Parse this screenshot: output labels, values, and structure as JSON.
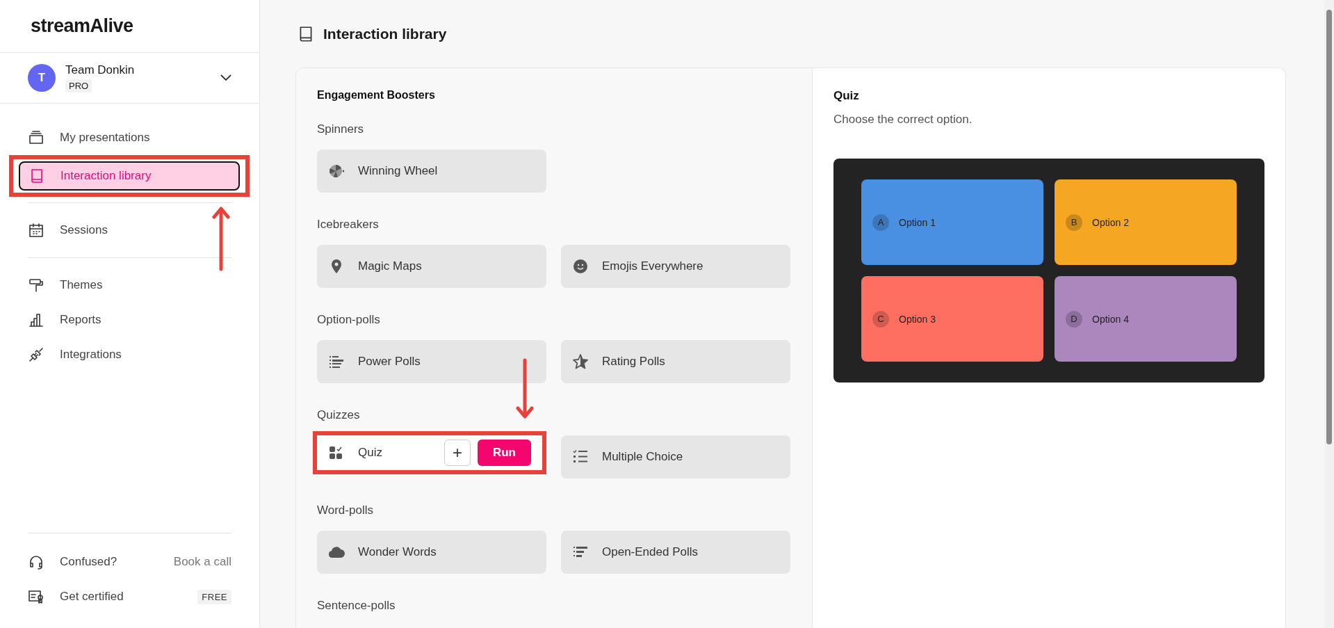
{
  "brand": {
    "logo": "streamAlive"
  },
  "team": {
    "initial": "T",
    "name": "Team Donkin",
    "plan": "PRO"
  },
  "nav_groups": [
    [
      {
        "label": "My presentations",
        "kind": "stack",
        "selected": false,
        "annotated": false
      },
      {
        "label": "Interaction library",
        "kind": "book",
        "selected": true,
        "annotated": true
      }
    ],
    [
      {
        "label": "Sessions",
        "kind": "calendar",
        "selected": false,
        "annotated": false
      }
    ],
    [
      {
        "label": "Themes",
        "kind": "roller",
        "selected": false,
        "annotated": false
      },
      {
        "label": "Reports",
        "kind": "chart",
        "selected": false,
        "annotated": false
      },
      {
        "label": "Integrations",
        "kind": "plug",
        "selected": false,
        "annotated": false
      }
    ]
  ],
  "help": [
    {
      "label": "Confused?",
      "kind": "headset",
      "action": "Book a call",
      "badge": false
    },
    {
      "label": "Get certified",
      "kind": "certificate",
      "action": "FREE",
      "badge": true
    }
  ],
  "page_title": "Interaction library",
  "library": {
    "heading": "Engagement Boosters",
    "sections": [
      {
        "title": "Spinners",
        "tiles": [
          {
            "label": "Winning Wheel",
            "kind": "wheel",
            "hovered": false,
            "annotated": false
          }
        ]
      },
      {
        "title": "Icebreakers",
        "tiles": [
          {
            "label": "Magic Maps",
            "kind": "pin",
            "hovered": false,
            "annotated": false
          },
          {
            "label": "Emojis Everywhere",
            "kind": "smiley",
            "hovered": false,
            "annotated": false
          }
        ]
      },
      {
        "title": "Option-polls",
        "tiles": [
          {
            "label": "Power Polls",
            "kind": "bars",
            "hovered": false,
            "annotated": false
          },
          {
            "label": "Rating Polls",
            "kind": "star",
            "hovered": false,
            "annotated": false
          }
        ]
      },
      {
        "title": "Quizzes",
        "tiles": [
          {
            "label": "Quiz",
            "kind": "quiz",
            "hovered": true,
            "annotated": true,
            "add_label": "+",
            "run_label": "Run"
          },
          {
            "label": "Multiple Choice",
            "kind": "list",
            "hovered": false,
            "annotated": false
          }
        ]
      },
      {
        "title": "Word-polls",
        "tiles": [
          {
            "label": "Wonder Words",
            "kind": "cloud",
            "hovered": false,
            "annotated": false
          },
          {
            "label": "Open-Ended Polls",
            "kind": "lines",
            "hovered": false,
            "annotated": false
          }
        ]
      },
      {
        "title": "Sentence-polls"
      }
    ]
  },
  "preview": {
    "title": "Quiz",
    "description": "Choose the correct option.",
    "options": [
      {
        "letter": "A",
        "label": "Option 1",
        "color": "#4a90e2"
      },
      {
        "letter": "B",
        "label": "Option 2",
        "color": "#f5a623"
      },
      {
        "letter": "C",
        "label": "Option 3",
        "color": "#ff6f61"
      },
      {
        "letter": "D",
        "label": "Option 4",
        "color": "#ab87bd"
      }
    ]
  }
}
